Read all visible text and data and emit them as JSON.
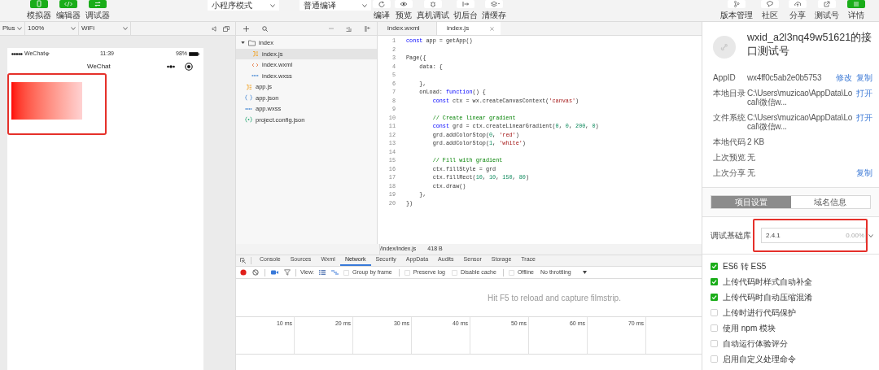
{
  "toolbar": {
    "left_buttons": [
      {
        "label": "模拟器",
        "on": true
      },
      {
        "label": "编辑器",
        "on": true
      },
      {
        "label": "调试器",
        "on": true
      }
    ],
    "dropdowns": [
      {
        "value": "小程序模式"
      },
      {
        "value": "普通编译"
      }
    ],
    "action_buttons": [
      {
        "label": "编译"
      },
      {
        "label": "预览"
      },
      {
        "label": "真机调试"
      },
      {
        "label": "切后台"
      },
      {
        "label": "清缓存"
      }
    ],
    "right_buttons": [
      {
        "label": "版本管理",
        "on": false
      },
      {
        "label": "社区",
        "on": false
      },
      {
        "label": "分享",
        "on": false
      },
      {
        "label": "测试号",
        "on": false
      },
      {
        "label": "详情",
        "on": true
      }
    ]
  },
  "simulator": {
    "device": "Plus",
    "zoom": "100%",
    "network": "WiFi",
    "status_bar": {
      "carrier": "WeChat",
      "time": "11:39",
      "battery": "98%"
    },
    "nav_title": "WeChat",
    "canvas_highlighted": true
  },
  "file_tree": [
    {
      "name": "index",
      "kind": "folder",
      "expanded": true,
      "selected": false,
      "children": [
        {
          "name": "index.js",
          "kind": "js",
          "selected": true
        },
        {
          "name": "index.wxml",
          "kind": "wxml",
          "selected": false
        },
        {
          "name": "index.wxss",
          "kind": "wxss",
          "selected": false
        }
      ]
    },
    {
      "name": "app.js",
      "kind": "js",
      "selected": false
    },
    {
      "name": "app.json",
      "kind": "json",
      "selected": false
    },
    {
      "name": "app.wxss",
      "kind": "wxss",
      "selected": false
    },
    {
      "name": "project.config.json",
      "kind": "config",
      "selected": false
    }
  ],
  "editor": {
    "tabs": [
      {
        "label": "index.wxml",
        "selected": false,
        "closable": false
      },
      {
        "label": "index.js",
        "selected": true,
        "closable": true
      }
    ],
    "lines": [
      {
        "number": "1",
        "tokens": [
          {
            "kind": "kw",
            "text": "const"
          },
          {
            "kind": "pl",
            "text": " app = getApp()"
          }
        ]
      },
      {
        "number": "2"
      },
      {
        "number": "3",
        "tokens": [
          {
            "kind": "pl",
            "text": "Page({"
          }
        ]
      },
      {
        "number": "4",
        "tokens": [
          {
            "kind": "pl",
            "text": "    data: {"
          }
        ]
      },
      {
        "number": "5"
      },
      {
        "number": "6",
        "tokens": [
          {
            "kind": "pl",
            "text": "    },"
          }
        ]
      },
      {
        "number": "7",
        "tokens": [
          {
            "kind": "pl",
            "text": "    onLoad: "
          },
          {
            "kind": "kw",
            "text": "function"
          },
          {
            "kind": "pl",
            "text": "() {"
          }
        ]
      },
      {
        "number": "8",
        "tokens": [
          {
            "kind": "kw",
            "text": "        const"
          },
          {
            "kind": "pl",
            "text": " ctx = wx.createCanvasContext("
          },
          {
            "kind": "str",
            "text": "'canvas'"
          },
          {
            "kind": "pl",
            "text": ")"
          }
        ]
      },
      {
        "number": "9"
      },
      {
        "number": "10",
        "tokens": [
          {
            "kind": "cm",
            "text": "        // Create linear gradient"
          }
        ]
      },
      {
        "number": "11",
        "tokens": [
          {
            "kind": "kw",
            "text": "        const"
          },
          {
            "kind": "pl",
            "text": " grd = ctx.createLinearGradient("
          },
          {
            "kind": "num",
            "text": "0"
          },
          {
            "kind": "pl",
            "text": ", "
          },
          {
            "kind": "num",
            "text": "0"
          },
          {
            "kind": "pl",
            "text": ", "
          },
          {
            "kind": "num",
            "text": "200"
          },
          {
            "kind": "pl",
            "text": ", "
          },
          {
            "kind": "num",
            "text": "0"
          },
          {
            "kind": "pl",
            "text": ")"
          }
        ]
      },
      {
        "number": "12",
        "tokens": [
          {
            "kind": "pl",
            "text": "        grd.addColorStop("
          },
          {
            "kind": "num",
            "text": "0"
          },
          {
            "kind": "pl",
            "text": ", "
          },
          {
            "kind": "str",
            "text": "'red'"
          },
          {
            "kind": "pl",
            "text": ")"
          }
        ]
      },
      {
        "number": "13",
        "tokens": [
          {
            "kind": "pl",
            "text": "        grd.addColorStop("
          },
          {
            "kind": "num",
            "text": "1"
          },
          {
            "kind": "pl",
            "text": ", "
          },
          {
            "kind": "str",
            "text": "'white'"
          },
          {
            "kind": "pl",
            "text": ")"
          }
        ]
      },
      {
        "number": "14"
      },
      {
        "number": "15",
        "tokens": [
          {
            "kind": "cm",
            "text": "        // Fill with gradient"
          }
        ]
      },
      {
        "number": "16",
        "tokens": [
          {
            "kind": "pl",
            "text": "        ctx.fillStyle = grd"
          }
        ]
      },
      {
        "number": "17",
        "tokens": [
          {
            "kind": "pl",
            "text": "        ctx.fillRect("
          },
          {
            "kind": "num",
            "text": "10"
          },
          {
            "kind": "pl",
            "text": ", "
          },
          {
            "kind": "num",
            "text": "10"
          },
          {
            "kind": "pl",
            "text": ", "
          },
          {
            "kind": "num",
            "text": "150"
          },
          {
            "kind": "pl",
            "text": ", "
          },
          {
            "kind": "num",
            "text": "80"
          },
          {
            "kind": "pl",
            "text": ")"
          }
        ]
      },
      {
        "number": "18",
        "tokens": [
          {
            "kind": "pl",
            "text": "        ctx.draw()"
          }
        ]
      },
      {
        "number": "19",
        "tokens": [
          {
            "kind": "pl",
            "text": "    },"
          }
        ]
      },
      {
        "number": "20",
        "tokens": [
          {
            "kind": "pl",
            "text": "})"
          }
        ]
      }
    ],
    "footer": {
      "path": "/index/index.js",
      "size": "418 B"
    }
  },
  "debugger": {
    "tabs": [
      {
        "label": "Console",
        "selected": false
      },
      {
        "label": "Sources",
        "selected": false
      },
      {
        "label": "Wxml",
        "selected": false
      },
      {
        "label": "Network",
        "selected": true
      },
      {
        "label": "Security",
        "selected": false
      },
      {
        "label": "AppData",
        "selected": false
      },
      {
        "label": "Audits",
        "selected": false
      },
      {
        "label": "Sensor",
        "selected": false
      },
      {
        "label": "Storage",
        "selected": false
      },
      {
        "label": "Trace",
        "selected": false
      }
    ],
    "view_label": "View:",
    "options": [
      {
        "label": "Group by frame",
        "checked": false
      },
      {
        "label": "Preserve log",
        "checked": false
      },
      {
        "label": "Disable cache",
        "checked": false
      },
      {
        "label": "Offline",
        "checked": false
      }
    ],
    "throttling": "No throttling",
    "message": "Hit F5 to reload and capture filmstrip.",
    "ticks": [
      "10 ms",
      "20 ms",
      "30 ms",
      "40 ms",
      "50 ms",
      "60 ms",
      "70 ms"
    ]
  },
  "details": {
    "title": "wxid_a2l3nq49w51621的接口测试号",
    "info": [
      {
        "label": "AppID",
        "value": "wx4ff0c5ab2e0b5753",
        "actions": [
          "修改",
          "复制"
        ]
      },
      {
        "label": "本地目录",
        "value": "C:\\Users\\muzicao\\AppData\\Local\\微信w...",
        "actions": [
          "打开"
        ]
      },
      {
        "label": "文件系统",
        "value": "C:\\Users\\muzicao\\AppData\\Local\\微信w...",
        "actions": [
          "打开"
        ]
      },
      {
        "label": "本地代码",
        "value": "2 KB"
      },
      {
        "label": "上次预览",
        "value": "无"
      },
      {
        "label": "上次分享",
        "value": "无",
        "actions": [
          "复制"
        ]
      }
    ],
    "tabs": [
      {
        "label": "项目设置",
        "selected": true
      },
      {
        "label": "域名信息",
        "selected": false
      }
    ],
    "library": {
      "label": "调试基础库",
      "value": "2.4.1",
      "percent": "0.00%",
      "highlighted": true
    },
    "options": [
      {
        "label": "ES6 转 ES5",
        "checked": true
      },
      {
        "label": "上传代码时样式自动补全",
        "checked": true
      },
      {
        "label": "上传代码时自动压缩混淆",
        "checked": true
      },
      {
        "label": "上传时进行代码保护",
        "checked": false
      },
      {
        "label": "使用 npm 模块",
        "checked": false
      },
      {
        "label": "自动运行体验评分",
        "checked": false
      },
      {
        "label": "启用自定义处理命令",
        "checked": false
      }
    ]
  }
}
